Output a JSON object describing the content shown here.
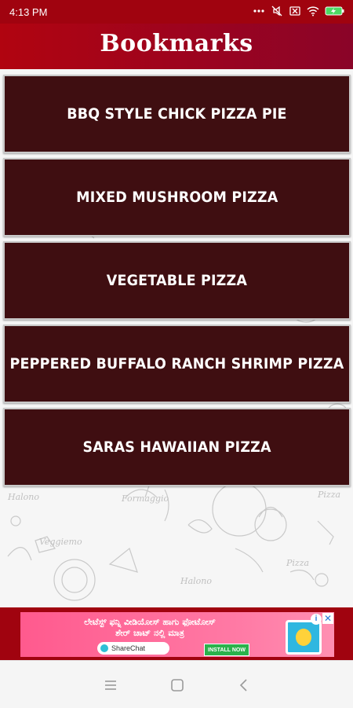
{
  "status_bar": {
    "time": "4:13 PM",
    "icons": [
      "dots-icon",
      "mute-icon",
      "no-sim-icon",
      "wifi-icon",
      "battery-charging-icon"
    ]
  },
  "header": {
    "title": "Bookmarks"
  },
  "bookmarks": [
    {
      "label": "BBQ STYLE CHICK PIZZA PIE"
    },
    {
      "label": "MIXED MUSHROOM PIZZA"
    },
    {
      "label": "VEGETABLE PIZZA"
    },
    {
      "label": "PEPPERED BUFFALO RANCH SHRIMP PIZZA"
    },
    {
      "label": "SARAS HAWAIIAN PIZZA"
    }
  ],
  "background_doodles": [
    "Halono",
    "Formaggio",
    "Veggiemo",
    "Halono",
    "Pizza",
    "Pizza"
  ],
  "ad": {
    "line1": "ಲೇಟೆಸ್ಟ್ ಫನ್ನಿ ವೀಡಿಯೋಸ್ ಹಾಗು ಫೋಟೋಸ್",
    "line2": "ಶೇರ್ ಚಾಟ್ ನಲ್ಲಿ ಮಾತ್ರ",
    "brand": "ShareChat",
    "install_label": "INSTALL NOW",
    "info_label": "i",
    "close_label": "✕"
  },
  "colors": {
    "primary": "#a0030f",
    "card": "#3f0e11",
    "background": "#f6f6f6"
  }
}
